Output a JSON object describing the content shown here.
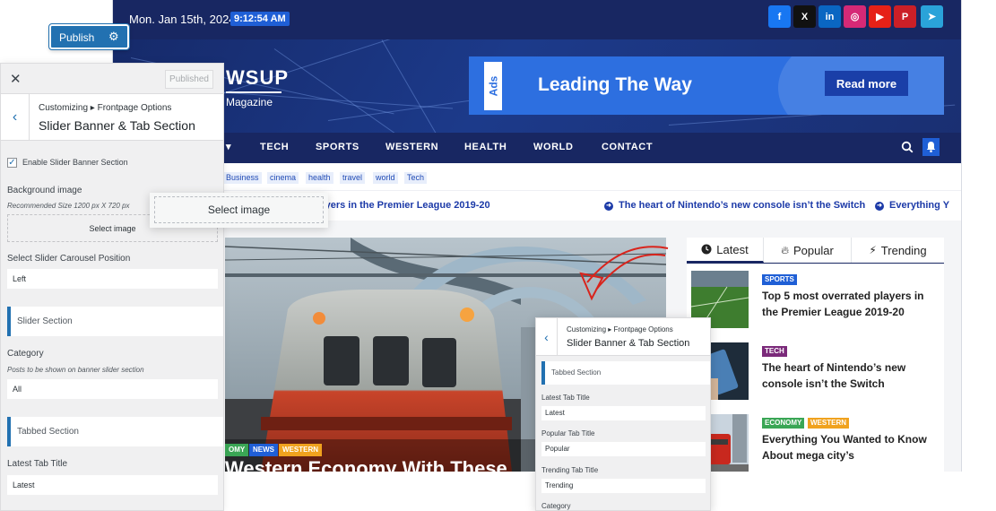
{
  "site": {
    "date": "Mon. Jan 15th, 2024",
    "time": "9:12:54 AM",
    "social": [
      {
        "name": "facebook-icon",
        "glyph": "f",
        "color": "#1877f2"
      },
      {
        "name": "x-icon",
        "glyph": "X",
        "color": "#111111"
      },
      {
        "name": "linkedin-icon",
        "glyph": "in",
        "color": "#0a66c2"
      },
      {
        "name": "instagram-icon",
        "glyph": "◎",
        "color": "#d62976"
      },
      {
        "name": "youtube-icon",
        "glyph": "▶",
        "color": "#e62117"
      },
      {
        "name": "pinterest-icon",
        "glyph": "P",
        "color": "#cb1f27"
      },
      {
        "name": "telegram-icon",
        "glyph": "➤",
        "color": "#2aa3d9"
      }
    ],
    "logo": {
      "text": "WSUP",
      "sub": "Magazine"
    },
    "ad": {
      "tag": "Ads",
      "title": "Leading The Way",
      "button": "Read more"
    },
    "nav": [
      "TECH",
      "SPORTS",
      "WESTERN",
      "HEALTH",
      "WORLD",
      "CONTACT"
    ],
    "tags": [
      "Business",
      "cinema",
      "health",
      "travel",
      "world",
      "Tech"
    ],
    "ticker": [
      "5 most overrated players in the Premier League 2019-20",
      "The heart of Nintendo’s new console isn’t the Switch",
      "Everything Y"
    ],
    "hero": {
      "categories": [
        {
          "label": "OMY",
          "color": "#3aa655"
        },
        {
          "label": "NEWS",
          "color": "#1f5fd6"
        },
        {
          "label": "WESTERN",
          "color": "#f0a21e"
        }
      ],
      "title": "Western Economy With These"
    },
    "tabs": [
      "Latest",
      "Popular",
      "Trending"
    ],
    "cards": [
      {
        "categories": [
          {
            "label": "SPORTS",
            "color": "#1f5fd6"
          }
        ],
        "title": "Top 5 most overrated players in the Premier League 2019-20"
      },
      {
        "categories": [
          {
            "label": "TECH",
            "color": "#7b2a7a"
          }
        ],
        "title": "The heart of Nintendo’s new console isn’t the Switch"
      },
      {
        "categories": [
          {
            "label": "ECONOMY",
            "color": "#3aa655"
          },
          {
            "label": "WESTERN",
            "color": "#f0a21e"
          }
        ],
        "title": "Everything You Wanted to Know About mega city’s"
      }
    ]
  },
  "customizer": {
    "publish": "Publish",
    "published": "Published",
    "breadcrumb": "Customizing ▸ Frontpage Options",
    "title": "Slider Banner & Tab Section",
    "enable_label": "Enable Slider Banner Section",
    "enable_checked": true,
    "bg_label": "Background image",
    "bg_hint": "Recommended Size 1200 px X 720 px",
    "select_image": "Select image",
    "position_label": "Select Slider Carousel Position",
    "position_value": "Left",
    "slider_section": "Slider Section",
    "category_label": "Category",
    "category_hint": "Posts to be shown on banner slider section",
    "category_value": "All",
    "tabbed_section": "Tabbed Section",
    "latest_tab_label": "Latest Tab Title",
    "latest_tab_value": "Latest"
  },
  "mini_panel": {
    "breadcrumb": "Customizing ▸ Frontpage Options",
    "title": "Slider Banner & Tab Section",
    "section": "Tabbed Section",
    "latest_label": "Latest Tab Title",
    "latest_value": "Latest",
    "popular_label": "Popular Tab Title",
    "popular_value": "Popular",
    "trending_label": "Trending Tab Title",
    "trending_value": "Trending",
    "category_label": "Category"
  }
}
